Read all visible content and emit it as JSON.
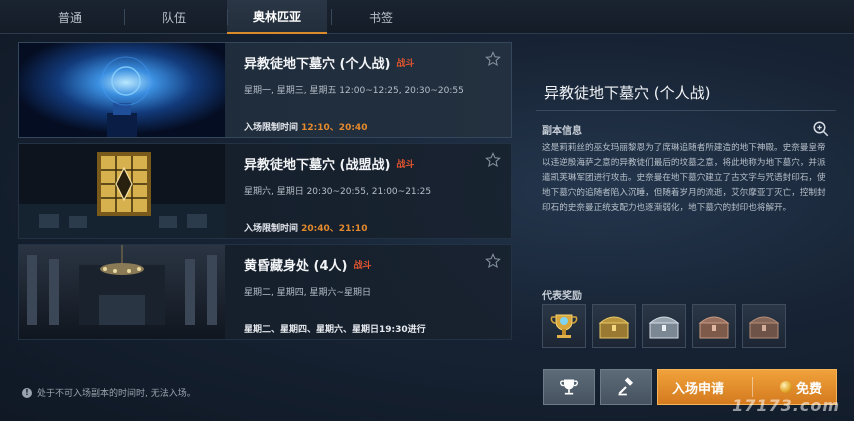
{
  "tabs": [
    {
      "label": "普通"
    },
    {
      "label": "队伍"
    },
    {
      "label": "奥林匹亚"
    },
    {
      "label": "书签"
    }
  ],
  "active_tab": "奥林匹亚",
  "dungeons": [
    {
      "title": "异教徒地下墓穴 (个人战)",
      "tag": "战斗",
      "schedule": "星期一, 星期三, 星期五  12:00~12:25, 20:30~20:55",
      "limit_label": "入场限制时间",
      "limit_value": "12:10、20:40",
      "thumb_icon": "blue-vortex-image"
    },
    {
      "title": "异教徒地下墓穴 (战盟战)",
      "tag": "战斗",
      "schedule": "星期六, 星期日  20:30~20:55, 21:00~21:25",
      "limit_label": "入场限制时间",
      "limit_value": "20:40、21:10",
      "thumb_icon": "golden-window-image"
    },
    {
      "title": "黄昏藏身处 (4人)",
      "tag": "战斗",
      "schedule": "星期二, 星期四, 星期六~星期日",
      "limit_label": "星期二、星期四、星期六、星期日19:30进行",
      "limit_value": "",
      "thumb_icon": "chandelier-hall-image"
    }
  ],
  "notice": "处于不可入场副本的时间时, 无法入场。",
  "detail": {
    "title": "异教徒地下墓穴 (个人战)",
    "info_header": "副本信息",
    "description": "这是莉莉丝的巫女玛丽黎恩为了席琳追随者所建造的地下神殿。史奈曼皇帝以违逆殷海萨之意的异教徒们最后的坟墓之意，将此地称为地下墓穴，并派遣凯芙琳军团进行攻击。史奈曼在地下墓穴建立了古文字与咒语封印石，使地下墓穴的追随者陷入沉睡，但随着岁月的流逝，艾尔摩亚丁灭亡，控制封印石的史奈曼正统支配力也逐渐弱化，地下墓穴的封印也将解开。",
    "rewards_header": "代表奖励",
    "rewards": [
      {
        "icon": "trophy-icon"
      },
      {
        "icon": "gold-chest-icon"
      },
      {
        "icon": "silver-chest-icon"
      },
      {
        "icon": "bronze-chest-icon"
      },
      {
        "icon": "copper-chest-icon"
      }
    ],
    "enter_label": "入场申请",
    "cost_label": "免费"
  },
  "watermark": "17173.com",
  "colors": {
    "accent": "#e58a2c",
    "tag_red": "#e0542e",
    "enter_button": "#e8932f"
  }
}
